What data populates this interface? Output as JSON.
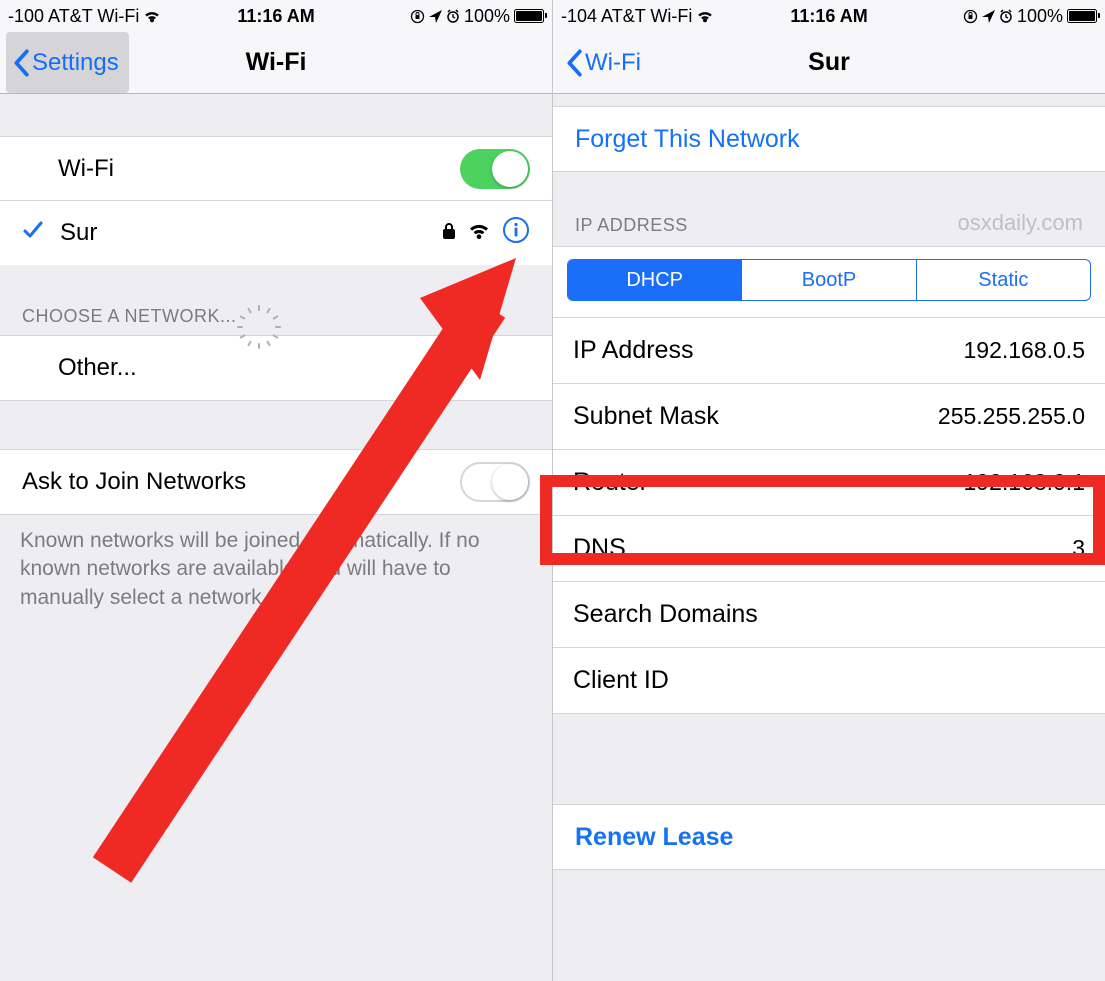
{
  "left": {
    "status": {
      "signal": "-100",
      "carrier": "AT&T Wi-Fi",
      "time": "11:16 AM",
      "battery": "100%"
    },
    "nav": {
      "back": "Settings",
      "title": "Wi-Fi"
    },
    "wifi_row_label": "Wi-Fi",
    "wifi_toggle_on": true,
    "connected_row": {
      "name": "Sur"
    },
    "choose_header": "CHOOSE A NETWORK...",
    "other_label": "Other...",
    "ask_label": "Ask to Join Networks",
    "ask_toggle_on": false,
    "ask_footer": "Known networks will be joined automatically. If no known networks are available, you will have to manually select a network."
  },
  "right": {
    "status": {
      "signal": "-104",
      "carrier": "AT&T Wi-Fi",
      "time": "11:16 AM",
      "battery": "100%"
    },
    "nav": {
      "back": "Wi-Fi",
      "title": "Sur"
    },
    "forget_label": "Forget This Network",
    "ip_section_header": "IP ADDRESS",
    "watermark": "osxdaily.com",
    "tabs": {
      "dhcp": "DHCP",
      "bootp": "BootP",
      "static": "Static"
    },
    "rows": {
      "ip_address": {
        "label": "IP Address",
        "value": "192.168.0.5"
      },
      "subnet": {
        "label": "Subnet Mask",
        "value": "255.255.255.0"
      },
      "router": {
        "label": "Router",
        "value": "192.168.0.1"
      },
      "dns": {
        "label": "DNS",
        "value": "3"
      },
      "search": {
        "label": "Search Domains",
        "value": ""
      },
      "client": {
        "label": "Client ID",
        "value": ""
      }
    },
    "renew_label": "Renew Lease"
  }
}
